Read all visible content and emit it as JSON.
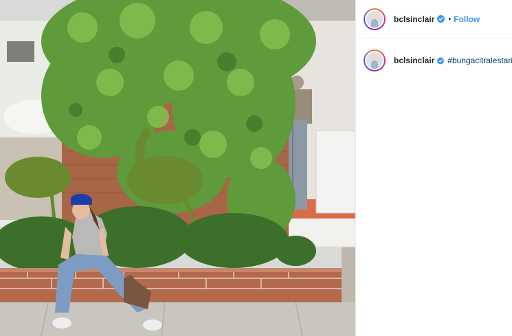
{
  "post": {
    "username": "bclsinclair",
    "follow_label": "Follow",
    "separator": "•",
    "caption_username": "bclsinclair",
    "caption_text": "#bungacitralestari"
  },
  "icons": {
    "verified": "verified-badge-icon"
  },
  "colors": {
    "follow": "#3897f0",
    "hashtag": "#003569",
    "username": "#262626",
    "verified": "#3897f0"
  }
}
